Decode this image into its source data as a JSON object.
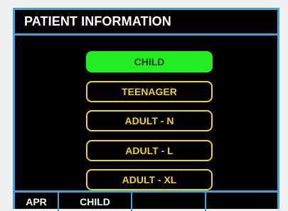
{
  "title": "PATIENT INFORMATION",
  "options": [
    {
      "label": "CHILD",
      "selected": true
    },
    {
      "label": "TEENAGER",
      "selected": false
    },
    {
      "label": "ADULT - N",
      "selected": false
    },
    {
      "label": "ADULT - L",
      "selected": false
    },
    {
      "label": "ADULT - XL",
      "selected": false
    }
  ],
  "status": [
    "APR",
    "CHILD",
    "",
    "",
    ""
  ],
  "colors": {
    "frame": "#3fa3d9",
    "option_border": "#f2d21a",
    "selected_fill": "#22ee22",
    "background": "#000000"
  }
}
